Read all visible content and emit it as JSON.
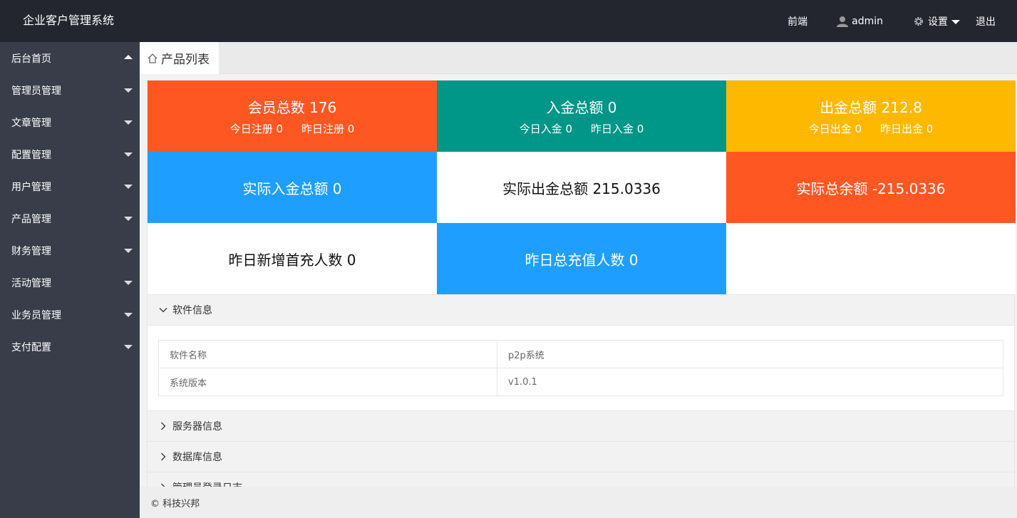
{
  "header": {
    "title": "企业客户管理系统",
    "nav": {
      "front": "前端",
      "user": "admin",
      "settings": "设置",
      "logout": "退出"
    }
  },
  "sidebar": {
    "items": [
      {
        "label": "后台首页"
      },
      {
        "label": "管理员管理"
      },
      {
        "label": "文章管理"
      },
      {
        "label": "配置管理"
      },
      {
        "label": "用户管理"
      },
      {
        "label": "产品管理"
      },
      {
        "label": "财务管理"
      },
      {
        "label": "活动管理"
      },
      {
        "label": "业务员管理"
      },
      {
        "label": "支付配置"
      }
    ]
  },
  "tab": {
    "label": "产品列表"
  },
  "stats": {
    "members": {
      "title": "会员总数 176",
      "today": "今日注册 0",
      "yesterday": "昨日注册 0",
      "color": "#ff5722"
    },
    "deposit": {
      "title": "入金总额 0",
      "today": "今日入金 0",
      "yesterday": "昨日入金 0",
      "color": "#009688"
    },
    "withdraw": {
      "title": "出金总额 212.8",
      "today": "今日出金 0",
      "yesterday": "昨日出金 0",
      "color": "#ffb800"
    },
    "real_deposit": {
      "title": "实际入金总额 0",
      "color": "#1e9fff"
    },
    "real_withdraw": {
      "title": "实际出金总额 215.0336",
      "color": "#ffffff"
    },
    "real_balance": {
      "title": "实际总余额 -215.0336",
      "color": "#ff5722"
    },
    "new_first_charge": {
      "title": "昨日新增首充人数 0",
      "color": "#ffffff"
    },
    "total_recharge": {
      "title": "昨日总充值人数 0",
      "color": "#1e9fff"
    }
  },
  "panels": {
    "software": {
      "title": "软件信息",
      "rows": [
        {
          "key": "软件名称",
          "value": "p2p系统"
        },
        {
          "key": "系统版本",
          "value": "v1.0.1"
        }
      ]
    },
    "server": {
      "title": "服务器信息"
    },
    "database": {
      "title": "数据库信息"
    },
    "login_log": {
      "title": "管理员登录日志"
    }
  },
  "footer": {
    "text": "© 科技兴邦"
  }
}
